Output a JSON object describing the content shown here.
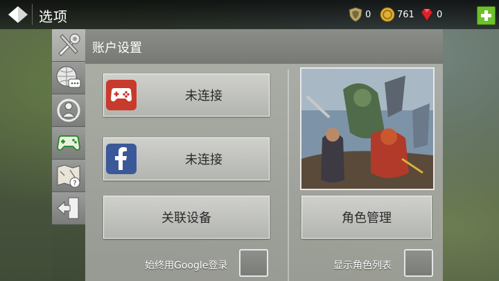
{
  "header": {
    "title": "选项",
    "resources": [
      {
        "name": "shield-currency",
        "value": "0"
      },
      {
        "name": "gold-currency",
        "value": "761"
      },
      {
        "name": "gem-currency",
        "value": "0"
      }
    ]
  },
  "sidebar": {
    "tabs": [
      {
        "icon": "tools-icon",
        "active": true
      },
      {
        "icon": "globe-chat-icon",
        "active": false
      },
      {
        "icon": "social-icon",
        "active": false
      },
      {
        "icon": "gamepad-icon",
        "active": false
      },
      {
        "icon": "map-help-icon",
        "active": false
      },
      {
        "icon": "exit-icon",
        "active": false
      }
    ]
  },
  "panel": {
    "title": "账户设置",
    "google_play": {
      "label": "未连接",
      "icon": "google-play-games-icon"
    },
    "facebook": {
      "label": "未连接",
      "icon": "facebook-icon"
    },
    "link_device": {
      "label": "关联设备"
    },
    "character_manage": {
      "label": "角色管理"
    },
    "always_google_label": "始终用Google登录",
    "show_char_list_label": "显示角色列表"
  },
  "colors": {
    "plus_button": "#6ec02c",
    "google_red": "#c83a2c",
    "facebook_blue": "#3b5998"
  }
}
